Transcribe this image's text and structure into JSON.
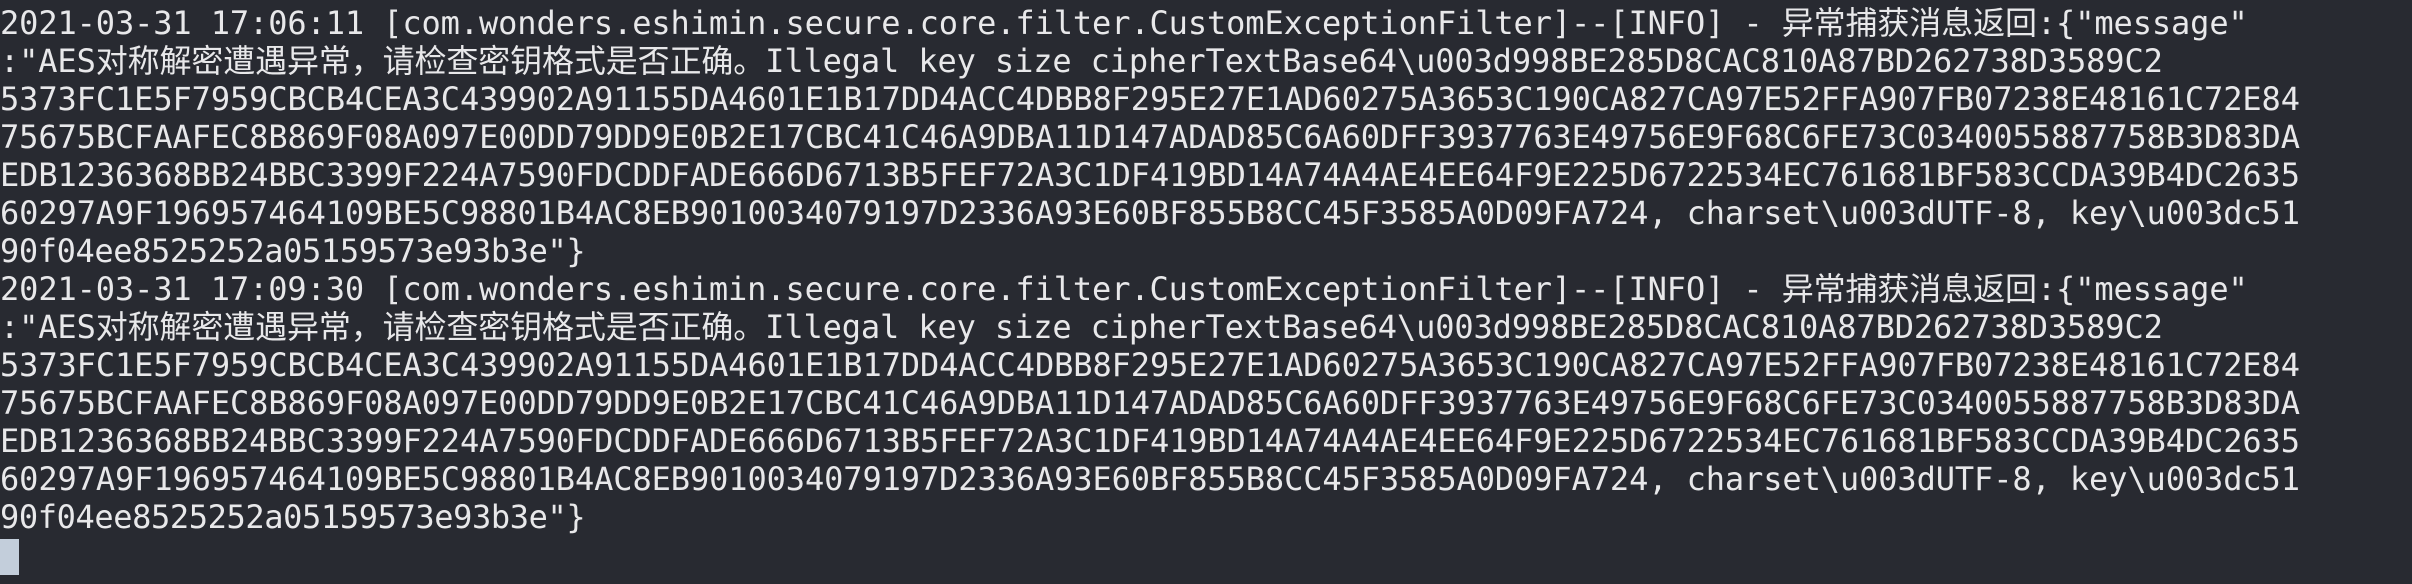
{
  "terminal": {
    "lines": [
      "2021-03-31 17:06:11 [com.wonders.eshimin.secure.core.filter.CustomExceptionFilter]--[INFO] - 异常捕获消息返回:{\"message\"",
      ":\"AES对称解密遭遇异常，请检查密钥格式是否正确。Illegal key size cipherTextBase64\\u003d998BE285D8CAC810A87BD262738D3589C2",
      "5373FC1E5F7959CBCB4CEA3C439902A91155DA4601E1B17DD4ACC4DBB8F295E27E1AD60275A3653C190CA827CA97E52FFA907FB07238E48161C72E84",
      "75675BCFAAFEC8B869F08A097E00DD79DD9E0B2E17CBC41C46A9DBA11D147ADAD85C6A60DFF3937763E49756E9F68C6FE73C0340055887758B3D83DA",
      "EDB1236368BB24BBC3399F224A7590FDCDDFADE666D6713B5FEF72A3C1DF419BD14A74A4AE4EE64F9E225D6722534EC761681BF583CCDA39B4DC2635",
      "60297A9F196957464109BE5C98801B4AC8EB9010034079197D2336A93E60BF855B8CC45F3585A0D09FA724, charset\\u003dUTF-8, key\\u003dc51",
      "90f04ee8525252a05159573e93b3e\"}",
      "2021-03-31 17:09:30 [com.wonders.eshimin.secure.core.filter.CustomExceptionFilter]--[INFO] - 异常捕获消息返回:{\"message\"",
      ":\"AES对称解密遭遇异常，请检查密钥格式是否正确。Illegal key size cipherTextBase64\\u003d998BE285D8CAC810A87BD262738D3589C2",
      "5373FC1E5F7959CBCB4CEA3C439902A91155DA4601E1B17DD4ACC4DBB8F295E27E1AD60275A3653C190CA827CA97E52FFA907FB07238E48161C72E84",
      "75675BCFAAFEC8B869F08A097E00DD79DD9E0B2E17CBC41C46A9DBA11D147ADAD85C6A60DFF3937763E49756E9F68C6FE73C0340055887758B3D83DA",
      "EDB1236368BB24BBC3399F224A7590FDCDDFADE666D6713B5FEF72A3C1DF419BD14A74A4AE4EE64F9E225D6722534EC761681BF583CCDA39B4DC2635",
      "60297A9F196957464109BE5C98801B4AC8EB9010034079197D2336A93E60BF855B8CC45F3585A0D09FA724, charset\\u003dUTF-8, key\\u003dc51",
      "90f04ee8525252a05159573e93b3e\"}"
    ],
    "colors": {
      "background": "#282a31",
      "foreground": "#e8e8ea",
      "cursor": "#c3cedb"
    }
  }
}
